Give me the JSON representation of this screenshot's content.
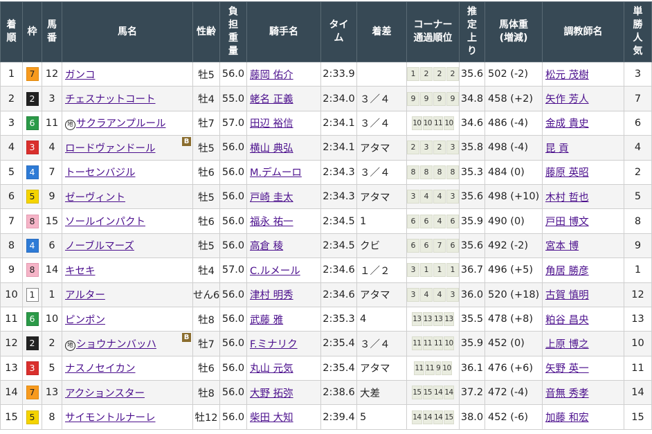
{
  "headers": {
    "rank": [
      "着",
      "順"
    ],
    "waku": [
      "枠"
    ],
    "umaban": [
      "馬",
      "番"
    ],
    "horse": [
      "馬名"
    ],
    "sexage": [
      "性齢"
    ],
    "weight": [
      "負",
      "担",
      "重",
      "量"
    ],
    "jockey": [
      "騎手名"
    ],
    "time": [
      "タイ",
      "ム"
    ],
    "margin": [
      "着差"
    ],
    "corner": [
      "コーナー",
      "通過順位"
    ],
    "last3f": [
      "推",
      "定",
      "上",
      "り"
    ],
    "body_weight": [
      "馬体重",
      "(増減)"
    ],
    "trainer": [
      "調教師名"
    ],
    "popularity": [
      "単",
      "勝",
      "人",
      "気"
    ]
  },
  "marks": {
    "chiho": "地",
    "blinker": "B"
  },
  "rows": [
    {
      "rank": "1",
      "waku": "7",
      "umaban": "12",
      "horse": "ガンコ",
      "chiho": false,
      "blinker": false,
      "sexage": "牡5",
      "weight": "56.0",
      "jockey": "藤岡 佑介",
      "time": "2:33.9",
      "margin": "",
      "corner": [
        "1",
        "2",
        "2",
        "2"
      ],
      "last3f": "35.6",
      "body_weight": "502 (-2)",
      "trainer": "松元 茂樹",
      "popularity": "3"
    },
    {
      "rank": "2",
      "waku": "2",
      "umaban": "3",
      "horse": "チェスナットコート",
      "chiho": false,
      "blinker": false,
      "sexage": "牡4",
      "weight": "55.0",
      "jockey": "蛯名 正義",
      "time": "2:34.0",
      "margin": "３／４",
      "corner": [
        "9",
        "9",
        "9",
        "9"
      ],
      "last3f": "34.8",
      "body_weight": "458 (+2)",
      "trainer": "矢作 芳人",
      "popularity": "7"
    },
    {
      "rank": "3",
      "waku": "6",
      "umaban": "11",
      "horse": "サクラアンプルール",
      "chiho": true,
      "blinker": false,
      "sexage": "牡7",
      "weight": "57.0",
      "jockey": "田辺 裕信",
      "time": "2:34.1",
      "margin": "３／４",
      "corner": [
        "10",
        "10",
        "11",
        "10"
      ],
      "last3f": "34.6",
      "body_weight": "486 (-4)",
      "trainer": "金成 貴史",
      "popularity": "6"
    },
    {
      "rank": "4",
      "waku": "3",
      "umaban": "4",
      "horse": "ロードヴァンドール",
      "chiho": false,
      "blinker": true,
      "sexage": "牡5",
      "weight": "56.0",
      "jockey": "横山 典弘",
      "time": "2:34.1",
      "margin": "アタマ",
      "corner": [
        "2",
        "3",
        "2",
        "3"
      ],
      "last3f": "35.8",
      "body_weight": "498 (-4)",
      "trainer": "昆 貢",
      "popularity": "4"
    },
    {
      "rank": "5",
      "waku": "4",
      "umaban": "7",
      "horse": "トーセンバジル",
      "chiho": false,
      "blinker": false,
      "sexage": "牡6",
      "weight": "56.0",
      "jockey": "M.デムーロ",
      "time": "2:34.3",
      "margin": "３／４",
      "corner": [
        "8",
        "8",
        "8",
        "8"
      ],
      "last3f": "35.3",
      "body_weight": "484 (0)",
      "trainer": "藤原 英昭",
      "popularity": "2"
    },
    {
      "rank": "6",
      "waku": "5",
      "umaban": "9",
      "horse": "ゼーヴィント",
      "chiho": false,
      "blinker": false,
      "sexage": "牡5",
      "weight": "56.0",
      "jockey": "戸崎 圭太",
      "time": "2:34.3",
      "margin": "アタマ",
      "corner": [
        "3",
        "4",
        "4",
        "3"
      ],
      "last3f": "35.6",
      "body_weight": "498 (+10)",
      "trainer": "木村 哲也",
      "popularity": "5"
    },
    {
      "rank": "7",
      "waku": "8",
      "umaban": "15",
      "horse": "ソールインパクト",
      "chiho": false,
      "blinker": false,
      "sexage": "牡6",
      "weight": "56.0",
      "jockey": "福永 祐一",
      "time": "2:34.5",
      "margin": "1",
      "corner": [
        "6",
        "6",
        "4",
        "6"
      ],
      "last3f": "35.9",
      "body_weight": "490 (0)",
      "trainer": "戸田 博文",
      "popularity": "8"
    },
    {
      "rank": "8",
      "waku": "4",
      "umaban": "6",
      "horse": "ノーブルマーズ",
      "chiho": false,
      "blinker": false,
      "sexage": "牡5",
      "weight": "56.0",
      "jockey": "高倉 稜",
      "time": "2:34.5",
      "margin": "クビ",
      "corner": [
        "6",
        "6",
        "7",
        "6"
      ],
      "last3f": "35.6",
      "body_weight": "492 (-2)",
      "trainer": "宮本 博",
      "popularity": "9"
    },
    {
      "rank": "9",
      "waku": "8",
      "umaban": "14",
      "horse": "キセキ",
      "chiho": false,
      "blinker": false,
      "sexage": "牡4",
      "weight": "57.0",
      "jockey": "C.ルメール",
      "time": "2:34.6",
      "margin": "１／２",
      "corner": [
        "3",
        "1",
        "1",
        "1"
      ],
      "last3f": "36.7",
      "body_weight": "496 (+5)",
      "trainer": "角居 勝彦",
      "popularity": "1"
    },
    {
      "rank": "10",
      "waku": "1",
      "umaban": "1",
      "horse": "アルター",
      "chiho": false,
      "blinker": false,
      "sexage": "せん6",
      "weight": "56.0",
      "jockey": "津村 明秀",
      "time": "2:34.6",
      "margin": "アタマ",
      "corner": [
        "3",
        "4",
        "4",
        "3"
      ],
      "last3f": "36.0",
      "body_weight": "520 (+18)",
      "trainer": "古賀 慎明",
      "popularity": "12"
    },
    {
      "rank": "11",
      "waku": "6",
      "umaban": "10",
      "horse": "ピンポン",
      "chiho": false,
      "blinker": false,
      "sexage": "牡8",
      "weight": "56.0",
      "jockey": "武藤 雅",
      "time": "2:35.3",
      "margin": "4",
      "corner": [
        "13",
        "13",
        "13",
        "13"
      ],
      "last3f": "35.5",
      "body_weight": "478 (+8)",
      "trainer": "粕谷 昌央",
      "popularity": "13"
    },
    {
      "rank": "12",
      "waku": "2",
      "umaban": "2",
      "horse": "ショウナンバッハ",
      "chiho": true,
      "blinker": true,
      "sexage": "牡7",
      "weight": "56.0",
      "jockey": "F.ミナリク",
      "time": "2:35.4",
      "margin": "３／４",
      "corner": [
        "11",
        "11",
        "11",
        "10"
      ],
      "last3f": "35.9",
      "body_weight": "452 (0)",
      "trainer": "上原 博之",
      "popularity": "10"
    },
    {
      "rank": "13",
      "waku": "3",
      "umaban": "5",
      "horse": "ナスノセイカン",
      "chiho": false,
      "blinker": false,
      "sexage": "牡6",
      "weight": "56.0",
      "jockey": "丸山 元気",
      "time": "2:35.4",
      "margin": "アタマ",
      "corner": [
        "11",
        "11",
        "9",
        "10"
      ],
      "last3f": "36.1",
      "body_weight": "476 (+6)",
      "trainer": "矢野 英一",
      "popularity": "11"
    },
    {
      "rank": "14",
      "waku": "7",
      "umaban": "13",
      "horse": "アクションスター",
      "chiho": false,
      "blinker": false,
      "sexage": "牡8",
      "weight": "56.0",
      "jockey": "大野 拓弥",
      "time": "2:38.6",
      "margin": "大差",
      "corner": [
        "15",
        "15",
        "14",
        "14"
      ],
      "last3f": "37.2",
      "body_weight": "472 (-4)",
      "trainer": "音無 秀孝",
      "popularity": "14"
    },
    {
      "rank": "15",
      "waku": "5",
      "umaban": "8",
      "horse": "サイモントルナーレ",
      "chiho": false,
      "blinker": false,
      "sexage": "牡12",
      "weight": "56.0",
      "jockey": "柴田 大知",
      "time": "2:39.4",
      "margin": "5",
      "corner": [
        "14",
        "14",
        "14",
        "15"
      ],
      "last3f": "38.0",
      "body_weight": "452 (-6)",
      "trainer": "加藤 和宏",
      "popularity": "15"
    }
  ]
}
